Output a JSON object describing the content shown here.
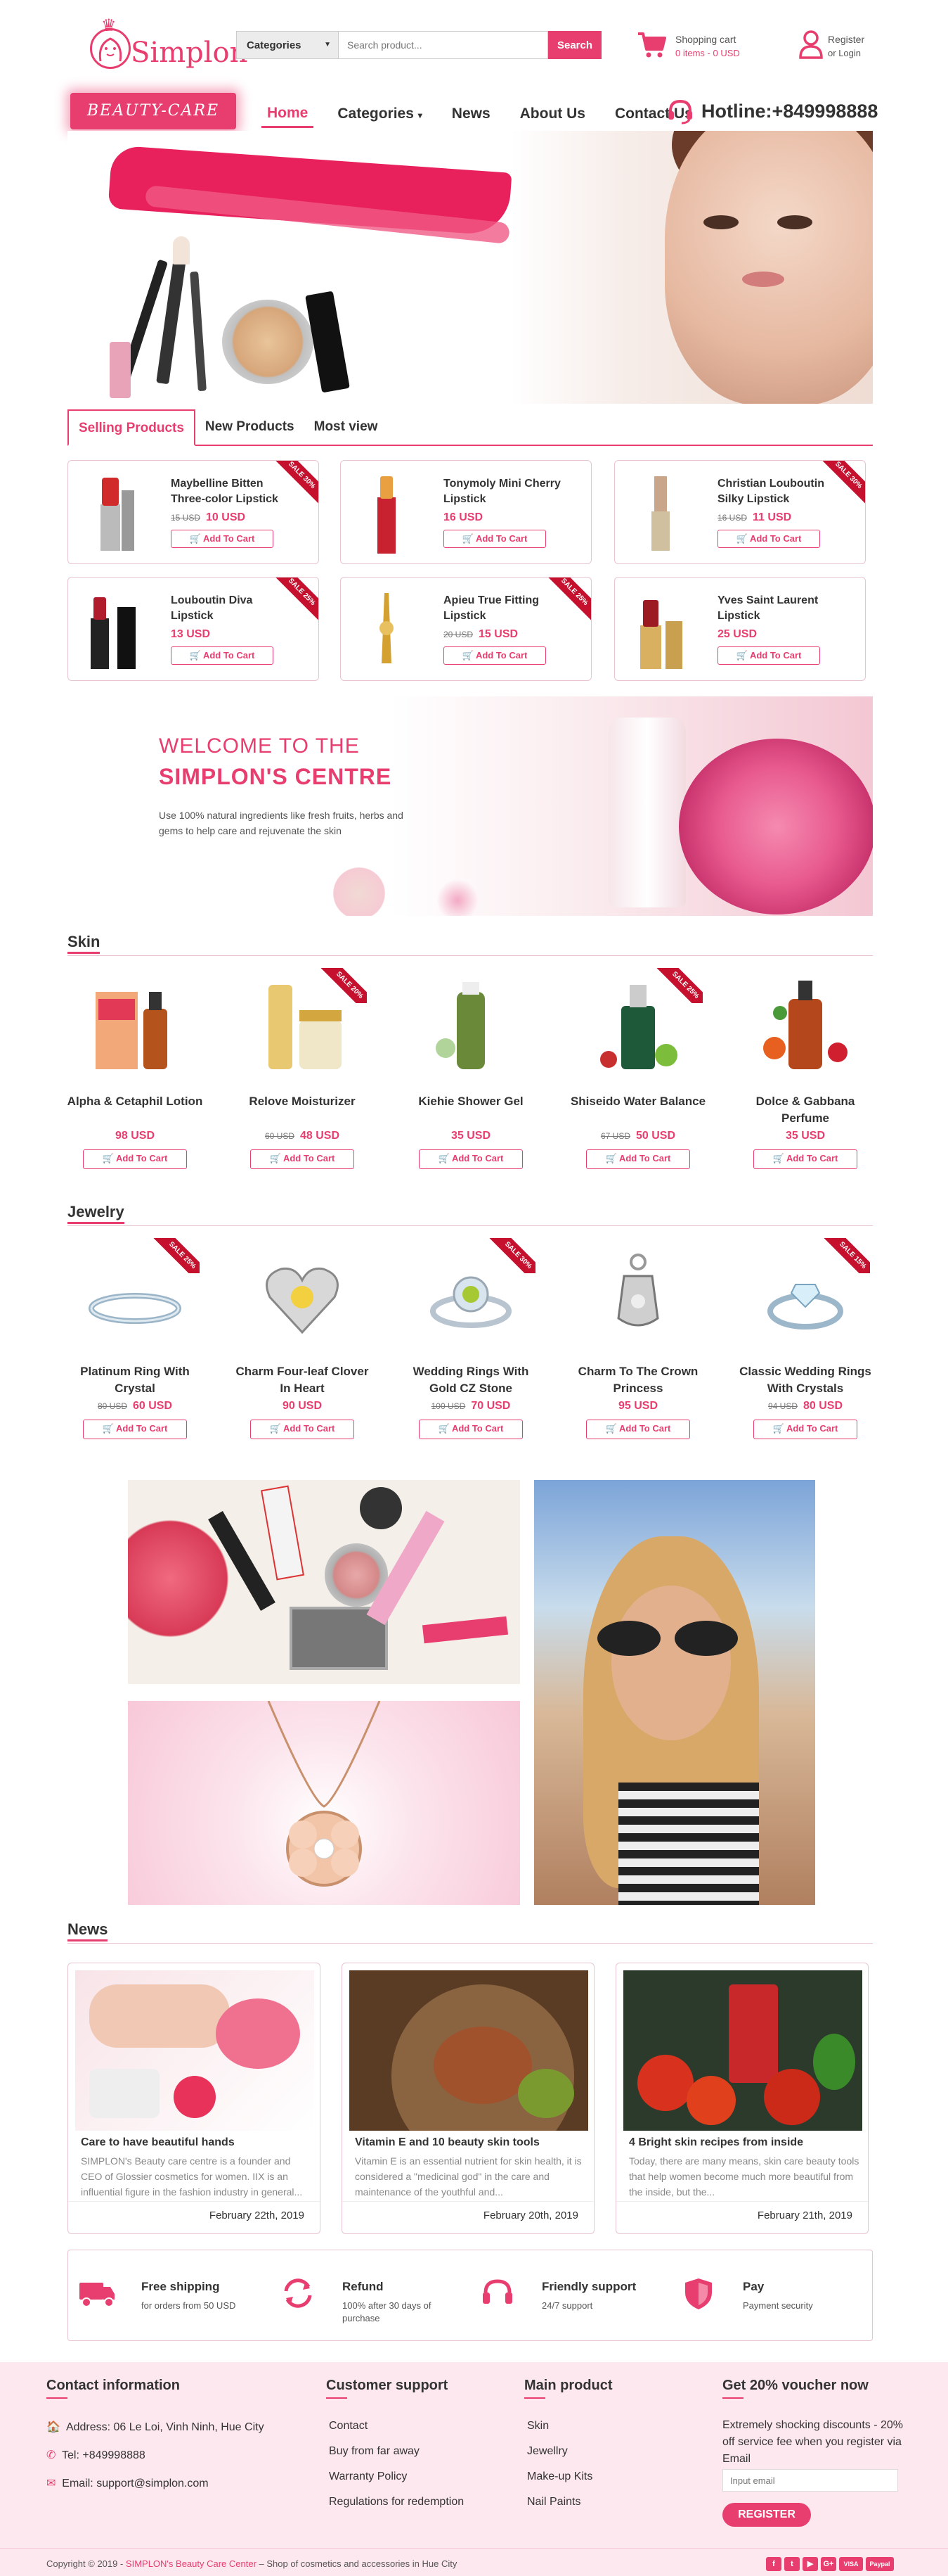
{
  "brand": {
    "name": "Simplon",
    "badge": "BEAUTY-CARE",
    "primary_color": "#e83e6f"
  },
  "search": {
    "category_label": "Categories",
    "placeholder": "Search product...",
    "button": "Search"
  },
  "cart": {
    "title": "Shopping cart",
    "items": "0 items",
    "sep": "-",
    "total": "0 USD"
  },
  "account": {
    "register": "Register",
    "or": "or",
    "login": "Login"
  },
  "nav": {
    "items": [
      "Home",
      "Categories",
      "News",
      "About Us",
      "Contact Us"
    ],
    "active": "Home",
    "hotline": "Hotline:+849998888"
  },
  "tabs": [
    "Selling Products",
    "New Products",
    "Most view"
  ],
  "selling": [
    {
      "name": "Maybelline Bitten Three-color Lipstick",
      "old": "15 USD",
      "price": "10 USD",
      "sale": "SALE 30%"
    },
    {
      "name": "Tonymoly Mini Cherry Lipstick",
      "old": "",
      "price": "16 USD",
      "sale": ""
    },
    {
      "name": "Christian Louboutin Silky Lipstick",
      "old": "16 USD",
      "price": "11 USD",
      "sale": "SALE 30%"
    },
    {
      "name": "Louboutin Diva Lipstick",
      "old": "",
      "price": "13 USD",
      "sale": "SALE 25%"
    },
    {
      "name": "Apieu True Fitting Lipstick",
      "old": "20 USD",
      "price": "15 USD",
      "sale": "SALE 25%"
    },
    {
      "name": "Yves Saint Laurent Lipstick",
      "old": "",
      "price": "25 USD",
      "sale": ""
    }
  ],
  "add_to_cart": "Add To Cart",
  "welcome": {
    "line1": "WELCOME TO THE",
    "line2": "SIMPLON'S CENTRE",
    "text": "Use 100% natural ingredients like fresh fruits, herbs and gems to help care and rejuvenate the skin"
  },
  "skin": {
    "title": "Skin",
    "items": [
      {
        "name": "Alpha & Cetaphil Lotion",
        "old": "",
        "price": "98 USD",
        "sale": ""
      },
      {
        "name": "Relove Moisturizer",
        "old": "60 USD",
        "price": "48 USD",
        "sale": "SALE 20%"
      },
      {
        "name": "Kiehie Shower Gel",
        "old": "",
        "price": "35 USD",
        "sale": ""
      },
      {
        "name": "Shiseido Water Balance",
        "old": "67 USD",
        "price": "50 USD",
        "sale": "SALE 25%"
      },
      {
        "name": "Dolce & Gabbana Perfume",
        "old": "",
        "price": "35 USD",
        "sale": ""
      }
    ]
  },
  "jewelry": {
    "title": "Jewelry",
    "items": [
      {
        "name": "Platinum Ring With Crystal",
        "old": "80 USD",
        "price": "60 USD",
        "sale": "SALE 25%"
      },
      {
        "name": "Charm Four-leaf Clover In Heart",
        "old": "",
        "price": "90 USD",
        "sale": ""
      },
      {
        "name": "Wedding Rings With Gold CZ Stone",
        "old": "100 USD",
        "price": "70 USD",
        "sale": "SALE 30%"
      },
      {
        "name": "Charm To The Crown Princess",
        "old": "",
        "price": "95 USD",
        "sale": ""
      },
      {
        "name": "Classic Wedding Rings With Crystals",
        "old": "94 USD",
        "price": "80 USD",
        "sale": "SALE 15%"
      }
    ]
  },
  "news": {
    "title": "News",
    "items": [
      {
        "title": "Care to have beautiful hands",
        "excerpt": "SIMPLON's Beauty care centre is a founder and CEO of Glossier cosmetics for women. IIX is an influential figure in the fashion industry in general...",
        "date": "February 22th, 2019"
      },
      {
        "title": "Vitamin E and 10 beauty skin tools",
        "excerpt": "Vitamin E is an essential nutrient for skin health, it is considered a \"medicinal god\" in the care and maintenance of the youthful and...",
        "date": "February 20th, 2019"
      },
      {
        "title": "4 Bright skin recipes from inside",
        "excerpt": "Today, there are many means, skin care beauty tools that help women become much more beautiful from the inside, but the...",
        "date": "February 21th, 2019"
      }
    ]
  },
  "services": [
    {
      "title": "Free shipping",
      "desc": "for orders from 50 USD",
      "icon": "truck-icon"
    },
    {
      "title": "Refund",
      "desc": "100% after 30 days of purchase",
      "icon": "refund-icon"
    },
    {
      "title": "Friendly support",
      "desc": "24/7 support",
      "icon": "headset-icon"
    },
    {
      "title": "Pay",
      "desc": "Payment security",
      "icon": "shield-icon"
    }
  ],
  "footer": {
    "contact": {
      "title": "Contact information",
      "address": "Address: 06 Le Loi, Vinh Ninh, Hue City",
      "tel": "Tel: +849998888",
      "email": "Email: support@simplon.com"
    },
    "support": {
      "title": "Customer support",
      "items": [
        "Contact",
        "Buy from far away",
        "Warranty Policy",
        "Regulations for redemption"
      ]
    },
    "main": {
      "title": "Main product",
      "items": [
        "Skin",
        "Jewellry",
        "Make-up Kits",
        "Nail Paints"
      ]
    },
    "voucher": {
      "title": "Get 20% voucher now",
      "text": "Extremely shocking discounts - 20% off service fee when you register via Email",
      "placeholder": "Input email",
      "button": "REGISTER"
    }
  },
  "copyright": {
    "prefix": "Copyright © 2019 - ",
    "brand": "SIMPLON's Beauty Care Center",
    "suffix": " – Shop of cosmetics and accessories in Hue City"
  },
  "social": [
    "f",
    "t",
    "▶",
    "G+",
    "VISA",
    "Paypal"
  ]
}
